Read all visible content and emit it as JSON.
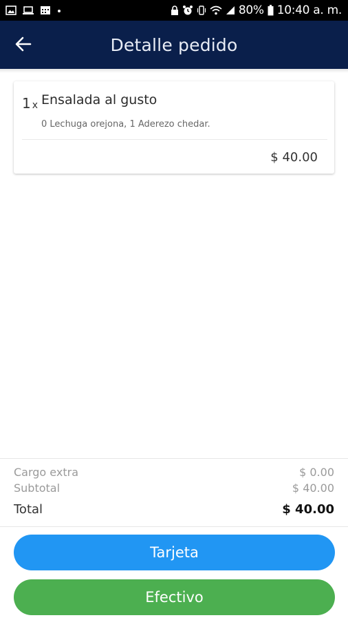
{
  "status_bar": {
    "battery_percent": "80%",
    "time": "10:40 a. m.",
    "left_icons": [
      "image-icon",
      "laptop-icon",
      "calendar-icon",
      "dot-icon"
    ],
    "right_icons": [
      "lock-icon",
      "alarm-icon",
      "vibrate-icon",
      "wifi-icon",
      "signal-icon",
      "battery-icon"
    ]
  },
  "header": {
    "title": "Detalle pedido",
    "back_icon": "arrow-left-icon"
  },
  "order_item": {
    "quantity": "1",
    "quantity_suffix": "x",
    "name": "Ensalada al gusto",
    "description": "0 Lechuga orejona, 1 Aderezo chedar.",
    "price": "$ 40.00"
  },
  "summary": {
    "extra_label": "Cargo extra",
    "extra_value": "$ 0.00",
    "subtotal_label": "Subtotal",
    "subtotal_value": "$ 40.00",
    "total_label": "Total",
    "total_value": "$ 40.00"
  },
  "buttons": {
    "card_label": "Tarjeta",
    "cash_label": "Efectivo"
  },
  "colors": {
    "header_bg": "#0a1f4b",
    "card_button": "#2196f3",
    "cash_button": "#4caf50"
  }
}
